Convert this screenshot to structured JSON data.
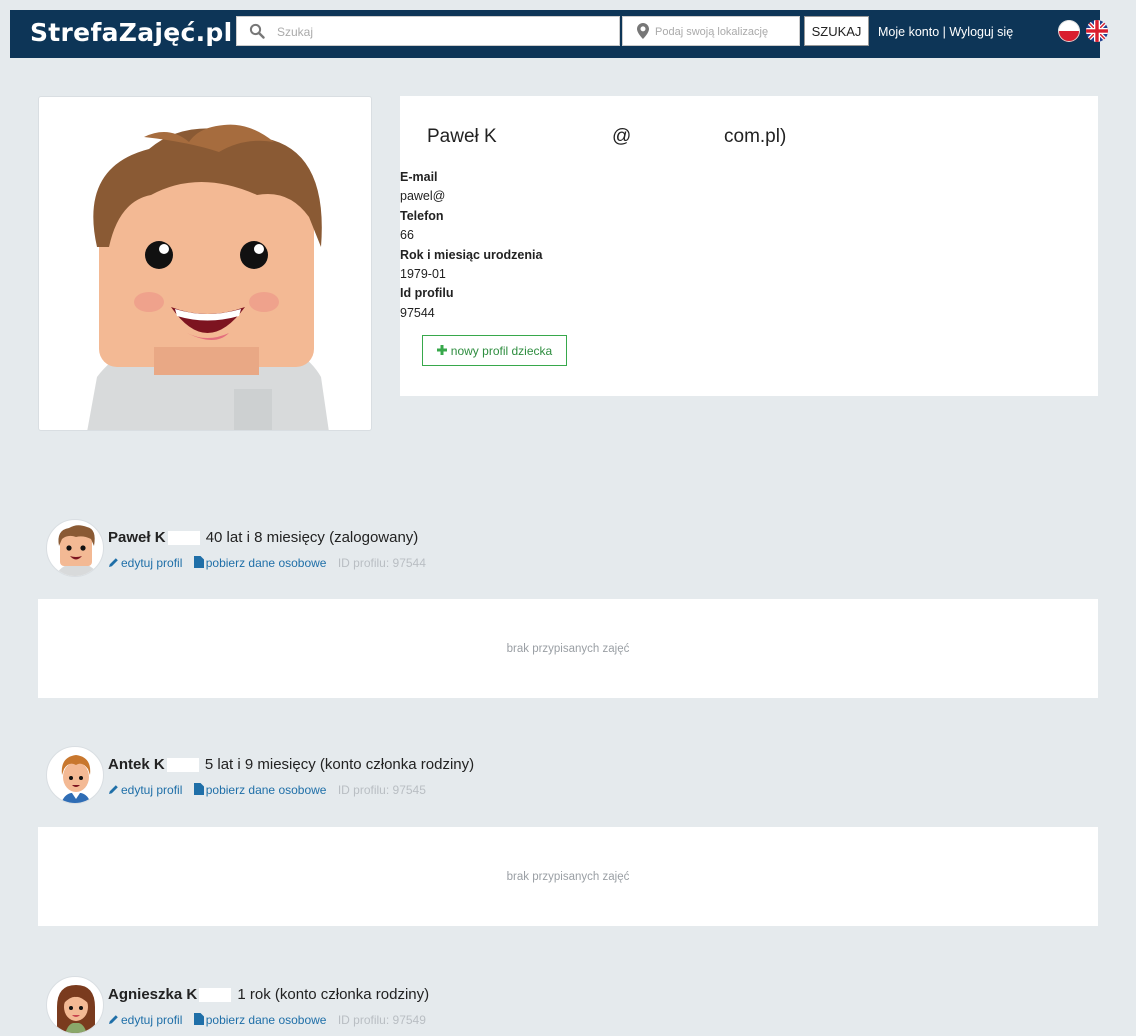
{
  "header": {
    "logo": "StrefaZajęć.pl",
    "search_placeholder": "Szukaj",
    "location_placeholder": "Podaj swoją lokalizację",
    "search_button": "SZUKAJ",
    "my_account": "Moje konto",
    "separator": " | ",
    "logout": "Wyloguj się",
    "colors": {
      "bar": "#0d3557"
    }
  },
  "profile": {
    "name": "Paweł K",
    "at_sign": "@",
    "domain": "com.pl)",
    "fields": [
      {
        "label": "E-mail",
        "value": "pawel@"
      },
      {
        "label": "Telefon",
        "value": "66"
      },
      {
        "label": "Rok i miesiąc urodzenia",
        "value": "1979-01"
      },
      {
        "label": "Id profilu",
        "value": "97544"
      }
    ],
    "new_child_button": "nowy profil dziecka"
  },
  "members": [
    {
      "name": "Paweł K",
      "age": "40 lat i 8 miesięcy (zalogowany)",
      "edit": "edytuj profil",
      "download": "pobierz dane osobowe",
      "profile_id": "ID profilu: 97544",
      "classes_text": "brak przypisanych zajęć"
    },
    {
      "name": "Antek K",
      "age": "5 lat i 9 miesięcy (konto członka rodziny)",
      "edit": "edytuj profil",
      "download": "pobierz dane osobowe",
      "profile_id": "ID profilu: 97545",
      "classes_text": "brak przypisanych zajęć"
    },
    {
      "name": "Agnieszka K",
      "age": "1 rok (konto członka rodziny)",
      "edit": "edytuj profil",
      "download": "pobierz dane osobowe",
      "profile_id": "ID profilu: 97549"
    }
  ]
}
